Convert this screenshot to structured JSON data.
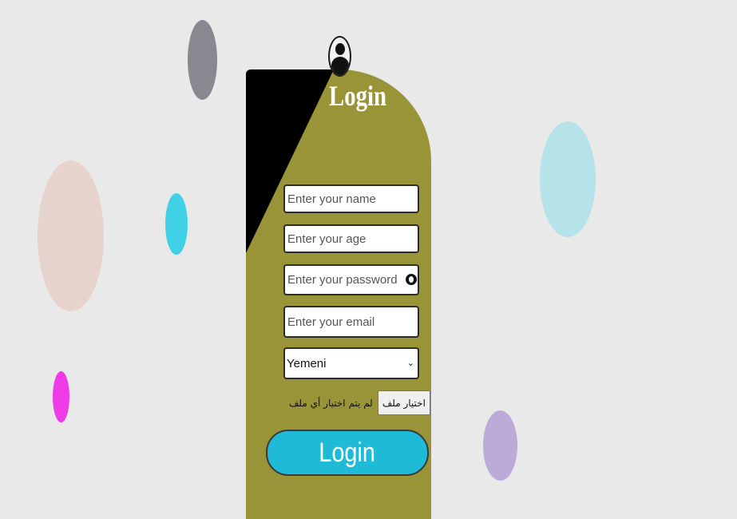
{
  "title": "Login",
  "form": {
    "name_placeholder": "Enter your name",
    "age_placeholder": "Enter your age",
    "password_placeholder": "Enter your password",
    "email_placeholder": "Enter your email",
    "nationality_value": "Yemeni",
    "file_button_label": "اختيار ملف",
    "file_status": "لم يتم اختيار أي ملف",
    "submit_label": "Login"
  },
  "icons": {
    "avatar": "user-avatar-icon",
    "eye": "eye-icon",
    "chevron": "chevron-down-icon"
  },
  "colors": {
    "background": "#e9e9e9",
    "card": "#9a9438",
    "card_corner": "#000000",
    "button": "#1fbad6",
    "text_light": "#ffffff",
    "bubbles": [
      "#8a8791",
      "#e6d3cb",
      "#41d1e7",
      "#b6e2ea",
      "#ef3ae8",
      "#bcabd9"
    ]
  }
}
